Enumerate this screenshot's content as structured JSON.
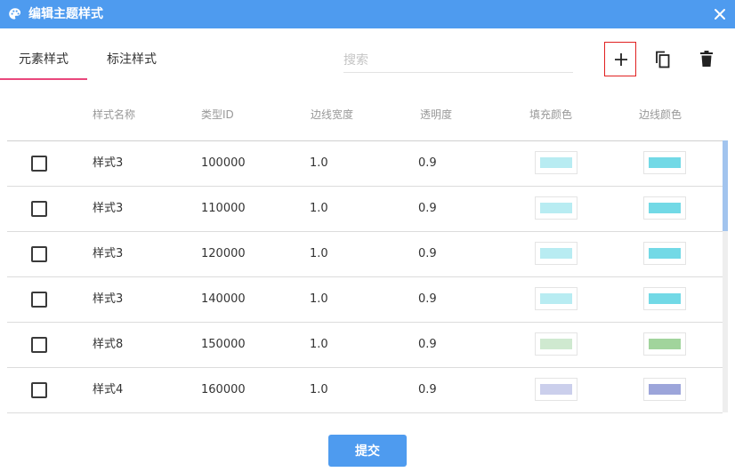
{
  "window": {
    "title": "编辑主题样式",
    "icon": "palette-icon",
    "close_icon": "close-icon"
  },
  "tabs": [
    {
      "label": "元素样式",
      "active": true
    },
    {
      "label": "标注样式",
      "active": false
    }
  ],
  "search": {
    "placeholder": "搜索",
    "value": ""
  },
  "toolbar": {
    "add_icon": "plus-icon",
    "copy_icon": "copy-icon",
    "delete_icon": "trash-icon",
    "accent_color": "#4e9bef",
    "active_tab_color": "#e9477c",
    "highlight_border_color": "#e02020"
  },
  "table": {
    "columns": [
      "样式名称",
      "类型ID",
      "边线宽度",
      "透明度",
      "填充颜色",
      "边线颜色"
    ],
    "rows": [
      {
        "name": "样式3",
        "type_id": "100000",
        "line_width": "1.0",
        "opacity": "0.9",
        "fill_color": "#b8ecf2",
        "line_color": "#72d9e6"
      },
      {
        "name": "样式3",
        "type_id": "110000",
        "line_width": "1.0",
        "opacity": "0.9",
        "fill_color": "#b8ecf2",
        "line_color": "#72d9e6"
      },
      {
        "name": "样式3",
        "type_id": "120000",
        "line_width": "1.0",
        "opacity": "0.9",
        "fill_color": "#b8ecf2",
        "line_color": "#72d9e6"
      },
      {
        "name": "样式3",
        "type_id": "140000",
        "line_width": "1.0",
        "opacity": "0.9",
        "fill_color": "#b8ecf2",
        "line_color": "#72d9e6"
      },
      {
        "name": "样式8",
        "type_id": "150000",
        "line_width": "1.0",
        "opacity": "0.9",
        "fill_color": "#cfe9d0",
        "line_color": "#a1d49c"
      },
      {
        "name": "样式4",
        "type_id": "160000",
        "line_width": "1.0",
        "opacity": "0.9",
        "fill_color": "#cbcfec",
        "line_color": "#9ca5da"
      }
    ]
  },
  "submit_label": "提交"
}
